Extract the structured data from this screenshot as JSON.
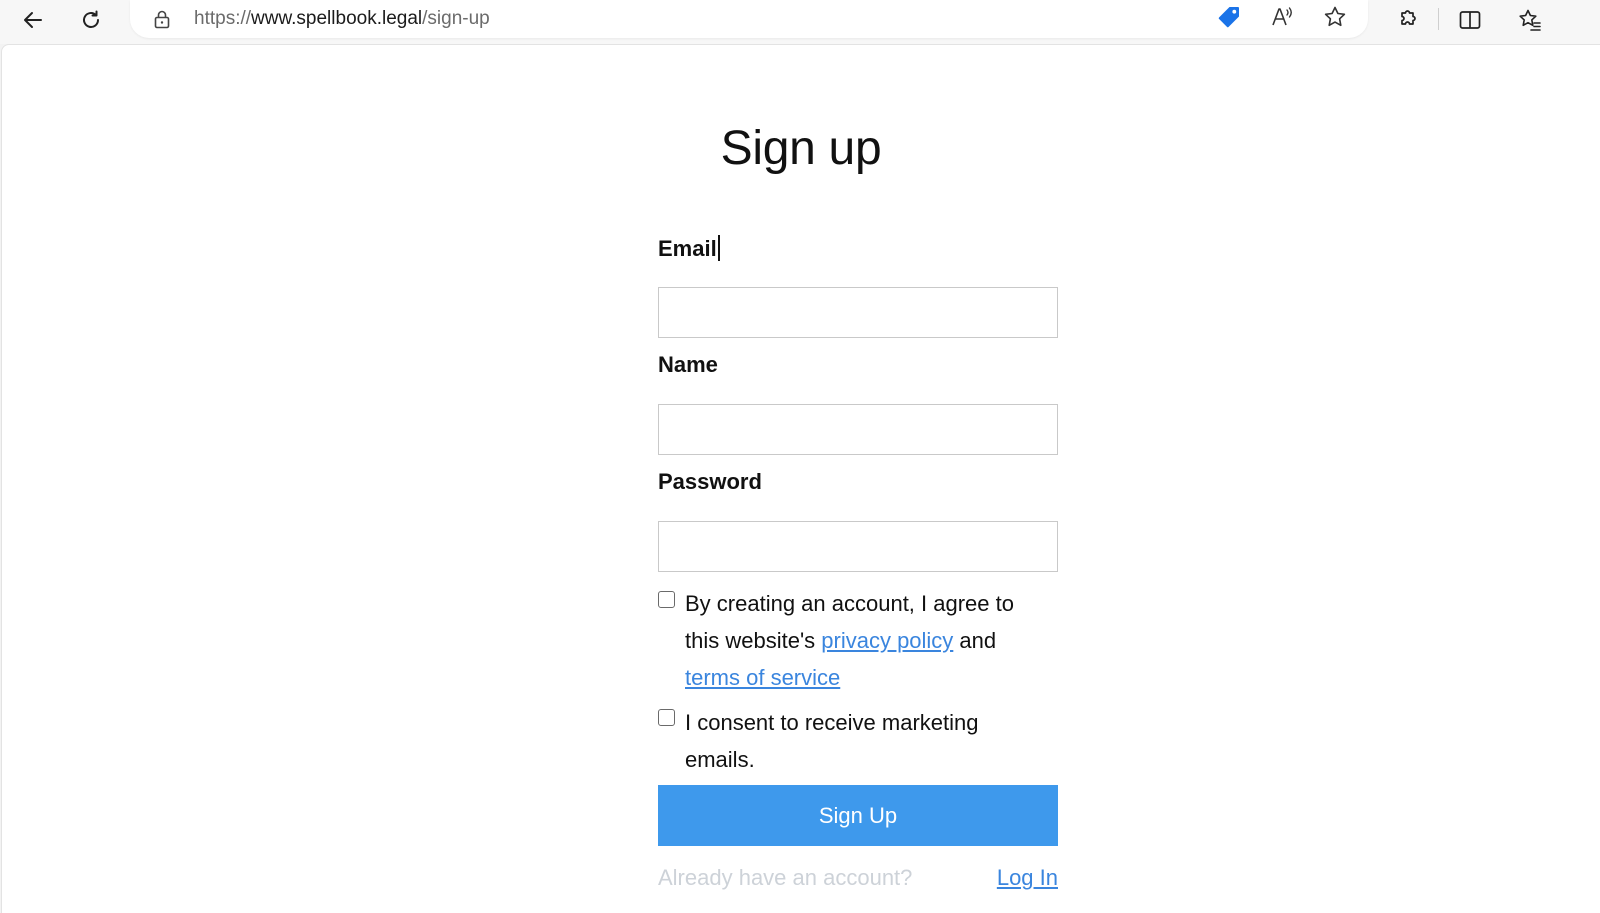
{
  "browser": {
    "url_protocol": "https://",
    "url_host": "www.spellbook.legal",
    "url_path": "/sign-up",
    "icons": {
      "back": "arrow-left-icon",
      "refresh": "refresh-icon",
      "lock": "lock-icon",
      "shopping": "tag-icon",
      "read_aloud": "read-aloud-icon",
      "favorite": "star-icon",
      "extensions": "puzzle-icon",
      "split_screen": "split-screen-icon",
      "favorites": "favorites-list-icon"
    },
    "accent_color": "#1a73e8"
  },
  "page": {
    "title": "Sign up",
    "form": {
      "email_label": "Email",
      "email_value": "",
      "name_label": "Name",
      "name_value": "",
      "password_label": "Password",
      "password_value": "",
      "terms": {
        "checked": false,
        "text_before": "By creating an account, I agree to this website's ",
        "privacy_link": "privacy policy",
        "text_middle": " and ",
        "terms_link": "terms of service"
      },
      "marketing": {
        "checked": false,
        "text": "I consent to receive marketing emails."
      },
      "submit_label": "Sign Up",
      "submit_color": "#3e99ec"
    },
    "footer": {
      "prompt": "Already have an account?",
      "login_link": "Log In"
    }
  }
}
